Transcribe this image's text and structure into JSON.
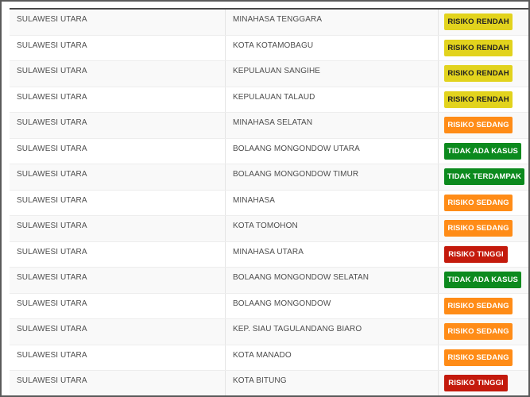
{
  "table": {
    "rows": [
      {
        "province": "SULAWESI UTARA",
        "regency": "MINAHASA TENGGARA",
        "status": "RISIKO RENDAH",
        "level": "rendah"
      },
      {
        "province": "SULAWESI UTARA",
        "regency": "KOTA KOTAMOBAGU",
        "status": "RISIKO RENDAH",
        "level": "rendah"
      },
      {
        "province": "SULAWESI UTARA",
        "regency": "KEPULAUAN SANGIHE",
        "status": "RISIKO RENDAH",
        "level": "rendah"
      },
      {
        "province": "SULAWESI UTARA",
        "regency": "KEPULAUAN TALAUD",
        "status": "RISIKO RENDAH",
        "level": "rendah"
      },
      {
        "province": "SULAWESI UTARA",
        "regency": "MINAHASA SELATAN",
        "status": "RISIKO SEDANG",
        "level": "sedang"
      },
      {
        "province": "SULAWESI UTARA",
        "regency": "BOLAANG MONGONDOW UTARA",
        "status": "TIDAK ADA KASUS",
        "level": "tidakada"
      },
      {
        "province": "SULAWESI UTARA",
        "regency": "BOLAANG MONGONDOW TIMUR",
        "status": "TIDAK TERDAMPAK",
        "level": "tidakterdampak"
      },
      {
        "province": "SULAWESI UTARA",
        "regency": "MINAHASA",
        "status": "RISIKO SEDANG",
        "level": "sedang"
      },
      {
        "province": "SULAWESI UTARA",
        "regency": "KOTA TOMOHON",
        "status": "RISIKO SEDANG",
        "level": "sedang"
      },
      {
        "province": "SULAWESI UTARA",
        "regency": "MINAHASA UTARA",
        "status": "RISIKO TINGGI",
        "level": "tinggi"
      },
      {
        "province": "SULAWESI UTARA",
        "regency": "BOLAANG MONGONDOW SELATAN",
        "status": "TIDAK ADA KASUS",
        "level": "tidakada"
      },
      {
        "province": "SULAWESI UTARA",
        "regency": "BOLAANG MONGONDOW",
        "status": "RISIKO SEDANG",
        "level": "sedang"
      },
      {
        "province": "SULAWESI UTARA",
        "regency": "KEP. SIAU TAGULANDANG BIARO",
        "status": "RISIKO SEDANG",
        "level": "sedang"
      },
      {
        "province": "SULAWESI UTARA",
        "regency": "KOTA MANADO",
        "status": "RISIKO SEDANG",
        "level": "sedang"
      },
      {
        "province": "SULAWESI UTARA",
        "regency": "KOTA BITUNG",
        "status": "RISIKO TINGGI",
        "level": "tinggi"
      }
    ]
  },
  "colors": {
    "rendah": "#e2d31d",
    "sedang": "#ff8c17",
    "tinggi": "#c41a0c",
    "tidak_ada_kasus": "#0c8a1e",
    "tidak_terdampak": "#0c8a1e"
  }
}
